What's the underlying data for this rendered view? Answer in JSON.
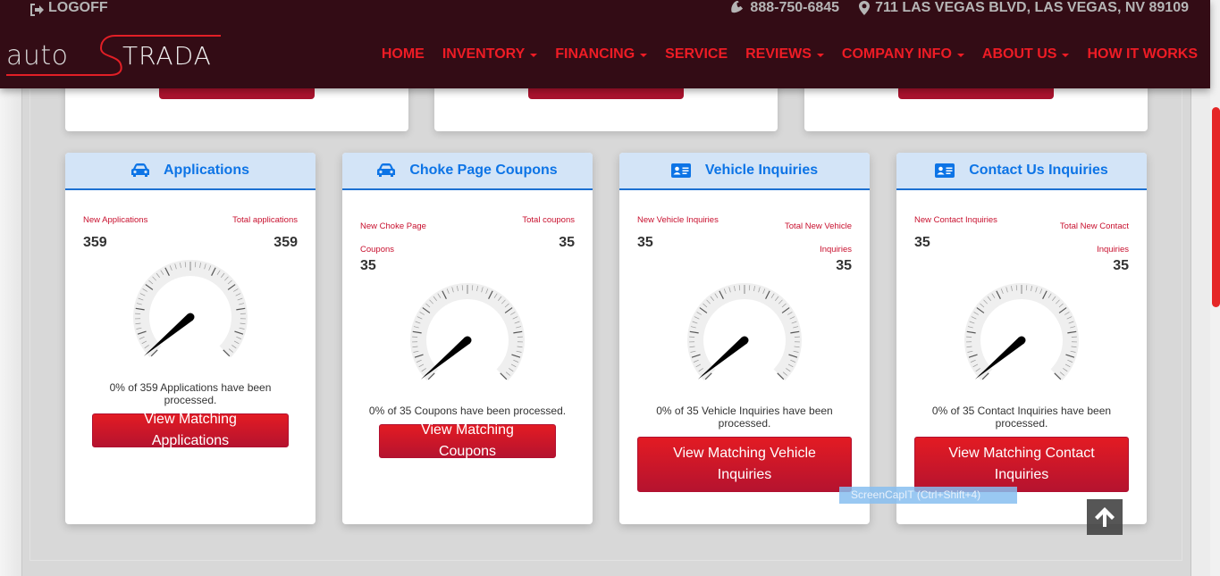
{
  "header": {
    "logoff_label": "LOGOFF",
    "phone": "888-750-6845",
    "address": "711 LAS VEGAS BLVD, LAS VEGAS, NV 89109",
    "logo_text_left": "auto",
    "logo_text_right": "TRADA",
    "nav": [
      {
        "label": "HOME",
        "dropdown": false
      },
      {
        "label": "INVENTORY",
        "dropdown": true
      },
      {
        "label": "FINANCING",
        "dropdown": true
      },
      {
        "label": "SERVICE",
        "dropdown": false
      },
      {
        "label": "REVIEWS",
        "dropdown": true
      },
      {
        "label": "COMPANY INFO",
        "dropdown": true
      },
      {
        "label": "ABOUT US",
        "dropdown": true
      },
      {
        "label": "HOW IT WORKS",
        "dropdown": false
      }
    ]
  },
  "colors": {
    "header_bg": "#330c15",
    "nav_red": "#ee1c25",
    "card_header_bg": "#d3e4f7",
    "card_title_blue": "#0d74e6",
    "button_red": "#c8102e"
  },
  "cards": [
    {
      "icon": "car-icon",
      "title": "Applications",
      "new_label": "New Applications",
      "new_value": "359",
      "total_label": "Total applications",
      "total_value": "359",
      "processed_percent": 0,
      "processed_text": "0% of 359 Applications have been processed.",
      "button_label": "View Matching Applications"
    },
    {
      "icon": "car-icon",
      "title": "Choke Page Coupons",
      "new_label": "New Choke Page Coupons",
      "new_value": "35",
      "total_label": "Total coupons",
      "total_value": "35",
      "processed_percent": 0,
      "processed_text": "0% of 35 Coupons have been processed.",
      "button_label": "View Matching Coupons"
    },
    {
      "icon": "id-card-icon",
      "title": "Vehicle Inquiries",
      "new_label": "New Vehicle Inquiries",
      "new_value": "35",
      "total_label": "Total New Vehicle Inquiries",
      "total_value": "35",
      "processed_percent": 0,
      "processed_text": "0% of 35 Vehicle Inquiries have been processed.",
      "button_label": "View Matching Vehicle Inquiries"
    },
    {
      "icon": "id-card-icon",
      "title": "Contact Us Inquiries",
      "new_label": "New Contact Inquiries",
      "new_value": "35",
      "total_label": "Total New Contact Inquiries",
      "total_value": "35",
      "processed_percent": 0,
      "processed_text": "0% of 35 Contact Inquiries have been processed.",
      "button_label": "View Matching Contact Inquiries"
    }
  ],
  "overlay": {
    "screencap_text": "ScreenCapIT  (Ctrl+Shift+4)"
  }
}
